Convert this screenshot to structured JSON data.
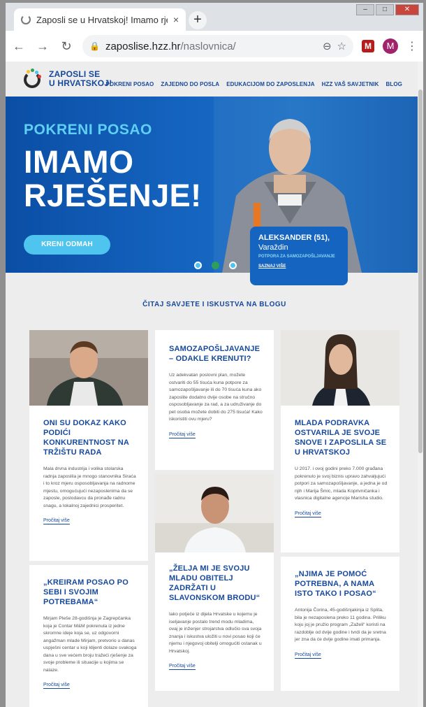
{
  "browser": {
    "tab_title": "Zaposli se u Hrvatskoj! Imamo rješenje!",
    "tab_close": "×",
    "new_tab": "+",
    "url_host": "zaposlise.hzz.hr",
    "url_path": "/naslovnica/",
    "profile_initial": "M",
    "extension_label": "M"
  },
  "site": {
    "logo_line1": "ZAPOSLI SE",
    "logo_line2": "U HRVATSKOJ!",
    "nav": [
      "POKRENI POSAO",
      "ZAJEDNO DO POSLA",
      "EDUKACIJOM DO ZAPOSLENJA",
      "HZZ VAŠ SAVJETNIK",
      "BLOG"
    ]
  },
  "hero": {
    "kicker": "POKRENI POSAO",
    "title_line1": "IMAMO",
    "title_line2": "RJEŠENJE!",
    "cta": "KRENI ODMAH",
    "person_name": "ALEKSANDER (51),",
    "person_city": "Varaždin",
    "person_tag": "POTPORA ZA SAMOZAPOŠLJAVANJE",
    "person_more": "SAZNAJ VIŠE"
  },
  "blog": {
    "heading": "ČITAJ SAVJETE I ISKUSTVA NA BLOGU",
    "read_more": "Pročitaj više",
    "posts": [
      {
        "title": "ONI SU DOKAZ KAKO PODIĆI KONKURENTNOST NA TRŽIŠTU RADA",
        "text": "Mala drvna industrija i volika stolarska radnja zaposlila je mnogo stanovnika Siraća i to kroz mjeru osposobljavanja na radnome mjestu, omogućujući nezaposlenima da se zaposle, poslodavcu da pronađe radnu snagu, a lokalnoj zajednici prosperitet."
      },
      {
        "title": "SAMOZAPOŠLJAVANJE – ODAKLE KRENUTI?",
        "text": "Uz adekvatan poslovni plan, možete ostvariti do 55 tisuća kuna potpore za samozapošljavanje ili do 70 tisuća kuna ako zaposlite dodatno dvije osobe na stručno osposobljavanje za rad, a za udruživanje do pet osoba možete dobiti do 275 tisuća! Kako iskoristiti ovu mjeru?"
      },
      {
        "title": "MLADA PODRAVKA OSTVARILA JE SVOJE SNOVE I ZAPOSLILA SE U HRVATSKOJ",
        "text": "U 2017. i ovoj godini preko 7.000 građana pokrenulo je svoj biznis upravo zahvaljujući potpori za samozapošljavanje, a jedna je od njih i Marija Šmic, mlada Koprivničanka i vlasnica digitalne agencije Marisha studio."
      },
      {
        "title": "„KREIRAM POSAO PO SEBI I SVOJIM POTREBAMA“",
        "text": "Mirjam Pleše 28-godišnja je Zagrepčanka koja je Contar M&M pokrenula iz jedne skromne ideje koja se, uz odgovorni angažman mlade Mirjam, pretvorio u danas uspješni centar u koji klijenti dolaze svakoga dana u sve većem broju tražeći rješenje za svoje probleme ili situacije u kojima se nalaze."
      },
      {
        "title": "„ŽELJA MI JE SVOJU MLADU OBITELJ ZADRŽATI U SLAVONSKOM BRODU“",
        "text": "Iako potječe iz dijela Hrvatske u kojemu je iseljavanje postalo trend modu mladima, ovaj je inženjer strojarstva odlučio sva svoja znanja i iskustva uložiti u novi posao koji će njemu i njegovoj obitelji omogućiti ostanak u Hrvatskoj."
      },
      {
        "title": "„NJIMA JE POMOĆ POTREBNA, A NAMA ISTO TAKO I POSAO“",
        "text": "Antonija Čorina, 45-godišnjakinja iz Splita, bila je nezaposlena preko 11 godina. Priliku koju joj je pružio program „Zaželi“ koristi na razdoblje od dvije godine i tvrdi da je sretna jer zna da će dvije godine imati primanja."
      }
    ]
  }
}
